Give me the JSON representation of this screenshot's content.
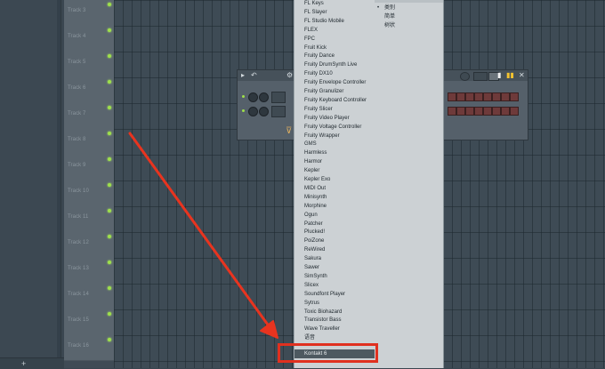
{
  "tracks": [
    {
      "label": "Track 3"
    },
    {
      "label": "Track 4"
    },
    {
      "label": "Track 5"
    },
    {
      "label": "Track 6"
    },
    {
      "label": "Track 7"
    },
    {
      "label": "Track 8"
    },
    {
      "label": "Track 9"
    },
    {
      "label": "Track 10"
    },
    {
      "label": "Track 11"
    },
    {
      "label": "Track 12"
    },
    {
      "label": "Track 13"
    },
    {
      "label": "Track 14"
    },
    {
      "label": "Track 15"
    },
    {
      "label": "Track 16"
    }
  ],
  "add_track_label": "+",
  "plugin_window": {
    "arrow_icon": "▸",
    "undo_icon": "↶",
    "close_icon": "✕",
    "gear_icon": "⚙"
  },
  "plugin_menu": {
    "items": [
      "FL Keys",
      "FL Slayer",
      "FL Studio Mobile",
      "FLEX",
      "FPC",
      "Fruit Kick",
      "Fruity Dance",
      "Fruity DrumSynth Live",
      "Fruity DX10",
      "Fruity Envelope Controller",
      "Fruity Granulizer",
      "Fruity Keyboard Controller",
      "Fruity Slicer",
      "Fruity Video Player",
      "Fruity Voltage Controller",
      "Fruity Wrapper",
      "GMS",
      "Harmless",
      "Harmor",
      "Kepler",
      "Kepler Exo",
      "MIDI Out",
      "Minisynth",
      "Morphine",
      "Ogun",
      "Patcher",
      "Plucked!",
      "PoiZone",
      "ReWired",
      "Sakura",
      "Sawer",
      "SimSynth",
      "Slicex",
      "Soundfont Player",
      "Sytrus",
      "Toxic Biohazard",
      "Transistor Bass",
      "Wave Traveller",
      "语音"
    ],
    "selected": "Kontakt 6"
  },
  "sort_options": [
    {
      "label": "类别",
      "active": true
    },
    {
      "label": "简单",
      "active": false
    },
    {
      "label": "树状",
      "active": false
    }
  ],
  "colors": {
    "led": "#9ee04a",
    "highlight": "#e0301f",
    "menu_bg": "#ccd1d4"
  }
}
